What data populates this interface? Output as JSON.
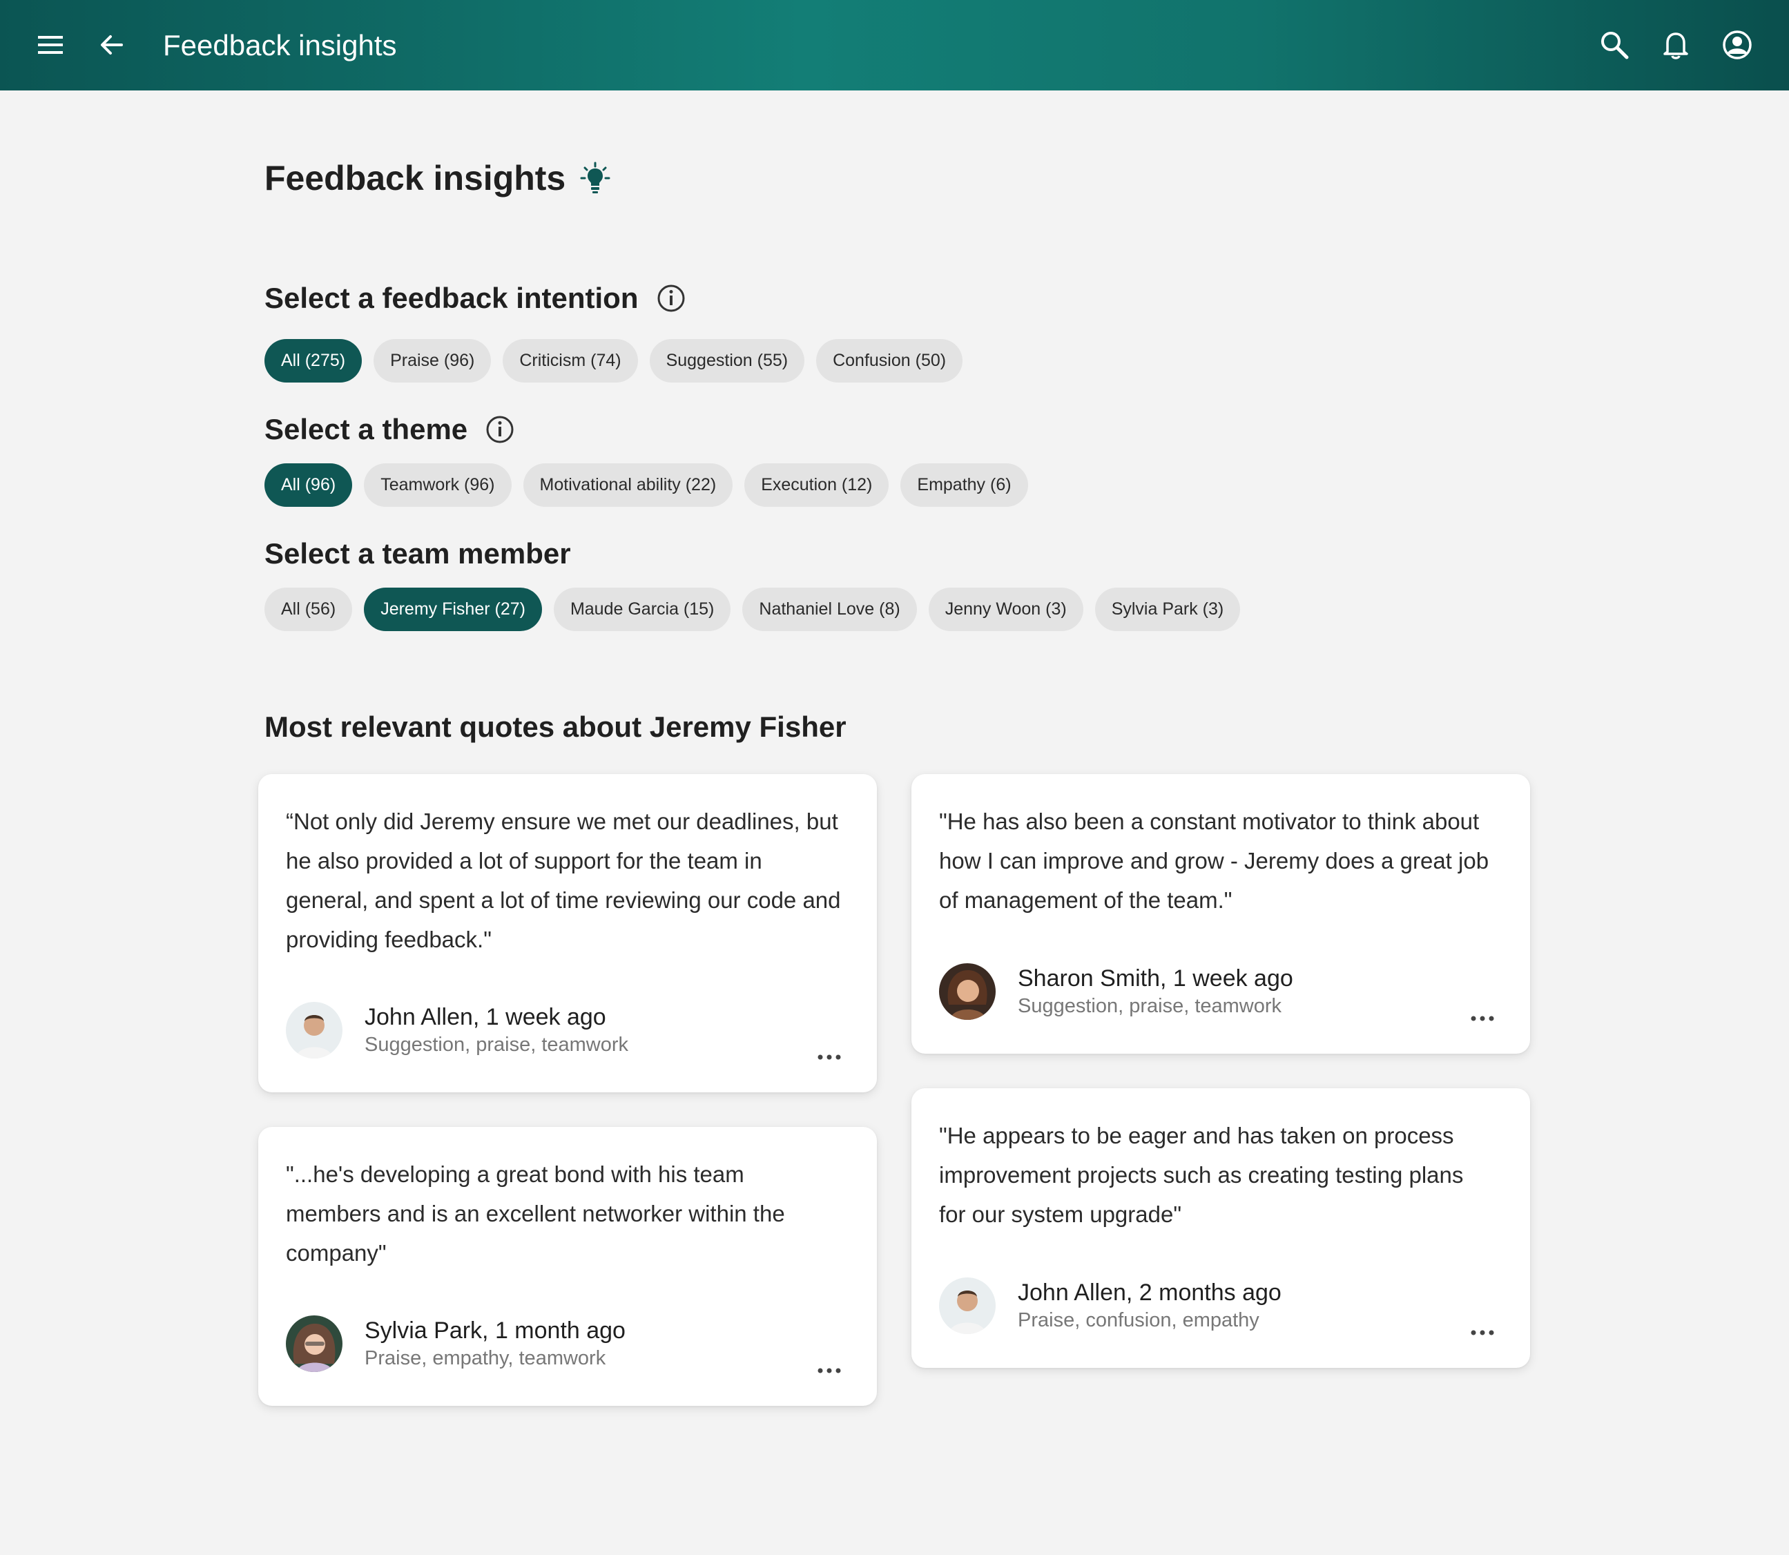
{
  "appbar": {
    "title": "Feedback insights",
    "icons": [
      "menu-icon",
      "back-arrow-icon",
      "search-icon",
      "bell-icon",
      "account-circle-icon"
    ]
  },
  "page": {
    "title": "Feedback insights",
    "title_icon": "lightbulb-icon"
  },
  "intention": {
    "label": "Select a feedback intention",
    "chips": [
      {
        "label": "All (275)",
        "selected": true
      },
      {
        "label": "Praise (96)",
        "selected": false
      },
      {
        "label": "Criticism (74)",
        "selected": false
      },
      {
        "label": "Suggestion (55)",
        "selected": false
      },
      {
        "label": "Confusion (50)",
        "selected": false
      }
    ]
  },
  "theme": {
    "label": "Select a theme",
    "chips": [
      {
        "label": "All (96)",
        "selected": true
      },
      {
        "label": "Teamwork (96)",
        "selected": false
      },
      {
        "label": "Motivational ability (22)",
        "selected": false
      },
      {
        "label": "Execution (12)",
        "selected": false
      },
      {
        "label": "Empathy (6)",
        "selected": false
      }
    ]
  },
  "member": {
    "label": "Select a team member",
    "chips": [
      {
        "label": "All (56)",
        "selected": false
      },
      {
        "label": "Jeremy Fisher (27)",
        "selected": true
      },
      {
        "label": "Maude Garcia (15)",
        "selected": false
      },
      {
        "label": "Nathaniel Love (8)",
        "selected": false
      },
      {
        "label": "Jenny Woon (3)",
        "selected": false
      },
      {
        "label": "Sylvia Park (3)",
        "selected": false
      }
    ]
  },
  "quotes": {
    "title": "Most relevant quotes about Jeremy Fisher",
    "items": [
      {
        "text": "“Not only did Jeremy ensure we met our deadlines, but he also provided a lot of support for the team in general, and spent a lot of time reviewing our code and providing feedback.\"",
        "author": "John Allen, 1 week ago",
        "tags": "Suggestion, praise, teamwork"
      },
      {
        "text": "\"He has also been a constant motivator to think about how I can improve and grow - Jeremy does a great job of management of the team.\"",
        "author": "Sharon Smith, 1 week ago",
        "tags": "Suggestion, praise, teamwork"
      },
      {
        "text": "\"...he's developing a great bond with his team members and is an excellent networker within the company\"",
        "author": "Sylvia Park, 1 month ago",
        "tags": "Praise, empathy, teamwork"
      },
      {
        "text": "\"He appears to be eager and has taken on process improvement projects such as creating testing plans for our system upgrade\"",
        "author": "John Allen, 2 months ago",
        "tags": "Praise, confusion, empathy"
      }
    ]
  },
  "colors": {
    "accent": "#0f5754",
    "chip": "#e3e3e3",
    "background": "#f3f3f3"
  }
}
